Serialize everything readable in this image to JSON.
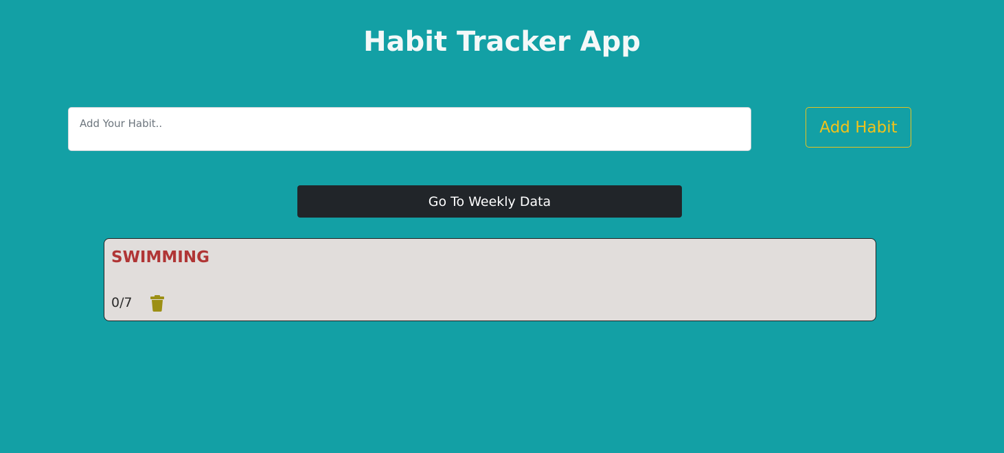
{
  "header": {
    "title": "Habit Tracker App"
  },
  "habit_form": {
    "placeholder": "Add Your Habit..",
    "value": "",
    "add_button_label": "Add Habit"
  },
  "navigation": {
    "weekly_button_label": "Go To Weekly Data"
  },
  "habits": [
    {
      "name": "SWIMMING",
      "progress": "0/7",
      "delete_icon": "trash-icon"
    }
  ],
  "colors": {
    "background": "#13a0a5",
    "accent_yellow": "#f1c21b",
    "habit_name": "#b03535",
    "trash_icon": "#9c8f14",
    "dark_button": "#212529",
    "card_background": "#e1dddb"
  }
}
